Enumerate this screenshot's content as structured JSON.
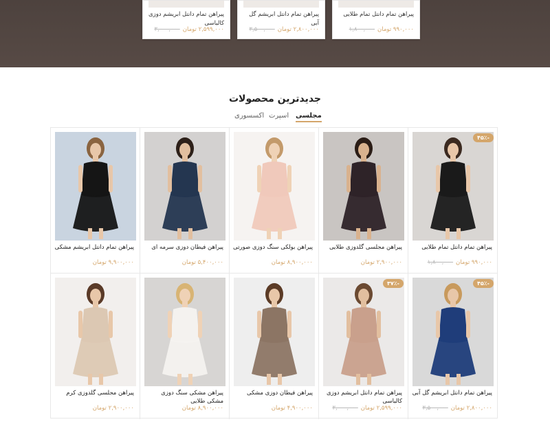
{
  "hero": {
    "cards": [
      {
        "title": "پیراهن تمام دانتل ابریشم دوزی کالباسی",
        "price": "۲,۵۹۹,۰۰۰ تومان",
        "old_price": "۳,۰۰۰,۰۰۰"
      },
      {
        "title": "پیراهن تمام دانتل ابریشم گل آبی",
        "price": "۲,۸۰۰,۰۰۰ تومان",
        "old_price": "۳,۵۰۰,۰۰۰"
      },
      {
        "title": "پیراهن تمام دانتل تمام طلایی",
        "price": "۹۹۰,۰۰۰ تومان",
        "old_price": "۱,۸۰۰,۰۰۰"
      }
    ]
  },
  "section": {
    "title": "جدیدترین محصولات",
    "tabs": [
      "مجلسی",
      "اسپرت",
      "اکسسوری"
    ]
  },
  "products": [
    {
      "name": "پیراهن تمام دانتل تمام طلایی",
      "price": "۹۹۰,۰۰۰ تومان",
      "old_price": "۱,۸۰۰,۰۰۰",
      "badge": "۴۵٪-",
      "bg": "#d9d6d3",
      "dress": "#1a1a1a",
      "skin": "#e8c7a9",
      "hair": "#3b2a20"
    },
    {
      "name": "پیراهن مجلسی گلدوزی طلایی",
      "price": "۲,۹۰۰,۰۰۰ تومان",
      "old_price": "",
      "badge": "",
      "bg": "#c9c5c2",
      "dress": "#2e2328",
      "skin": "#d9b28e",
      "hair": "#2b1d16"
    },
    {
      "name": "پیراهن بولکی سنگ دوزی صورتی",
      "price": "۸,۹۰۰,۰۰۰ تومان",
      "old_price": "",
      "badge": "",
      "bg": "#f6f3f1",
      "dress": "#f0c9bb",
      "skin": "#efd2b6",
      "hair": "#c39a6b"
    },
    {
      "name": "پیراهن فیطان دوزی سرمه ای",
      "price": "۵,۴۰۰,۰۰۰ تومان",
      "old_price": "",
      "badge": "",
      "bg": "#d3d1d0",
      "dress": "#243650",
      "skin": "#e2bf9f",
      "hair": "#2d2019"
    },
    {
      "name": "پیراهن تمام دانتل ابریشم مشکی",
      "price": "۹,۹۰۰,۰۰۰ تومان",
      "old_price": "",
      "badge": "",
      "bg": "#c9d4e0",
      "dress": "#151515",
      "skin": "#e8c7a9",
      "hair": "#8a6440"
    },
    {
      "name": "پیراهن تمام دانتل ابریشم گل آبی",
      "price": "۲,۸۰۰,۰۰۰ تومان",
      "old_price": "۳,۵۰۰,۰۰۰",
      "badge": "۴۵٪-",
      "bg": "#d9d9d9",
      "dress": "#1f3d7a",
      "skin": "#e8c7a9",
      "hair": "#c89a5d"
    },
    {
      "name": "پیراهن تمام دانتل ابریشم دوزی کالباسی",
      "price": "۲,۵۹۹,۰۰۰ تومان",
      "old_price": "۳,۰۰۰,۰۰۰",
      "badge": "۳۷٪-",
      "bg": "#ebe9e8",
      "dress": "#c9a08c",
      "skin": "#e2bf9f",
      "hair": "#6b4a32"
    },
    {
      "name": "پیراهن فیطان دوزی مشکی",
      "price": "۴,۹۰۰,۰۰۰ تومان",
      "old_price": "",
      "badge": "",
      "bg": "#eeeeee",
      "dress": "#8c7564",
      "skin": "#e8c7a9",
      "hair": "#5b3b26"
    },
    {
      "name": "پیراهن مشکی سنگ دوزی مشکی طلایی",
      "price": "۸,۹۰۰,۰۰۰ تومان",
      "old_price": "",
      "badge": "",
      "bg": "#d7d5d3",
      "dress": "#f4f2ef",
      "skin": "#efd2b6",
      "hair": "#d8b474"
    },
    {
      "name": "پیراهن مجلسی گلدوزی کرم",
      "price": "۲,۹۰۰,۰۰۰ تومان",
      "old_price": "",
      "badge": "",
      "bg": "#f2efed",
      "dress": "#dcc8b3",
      "skin": "#e8c7a9",
      "hair": "#5a3a28"
    }
  ]
}
